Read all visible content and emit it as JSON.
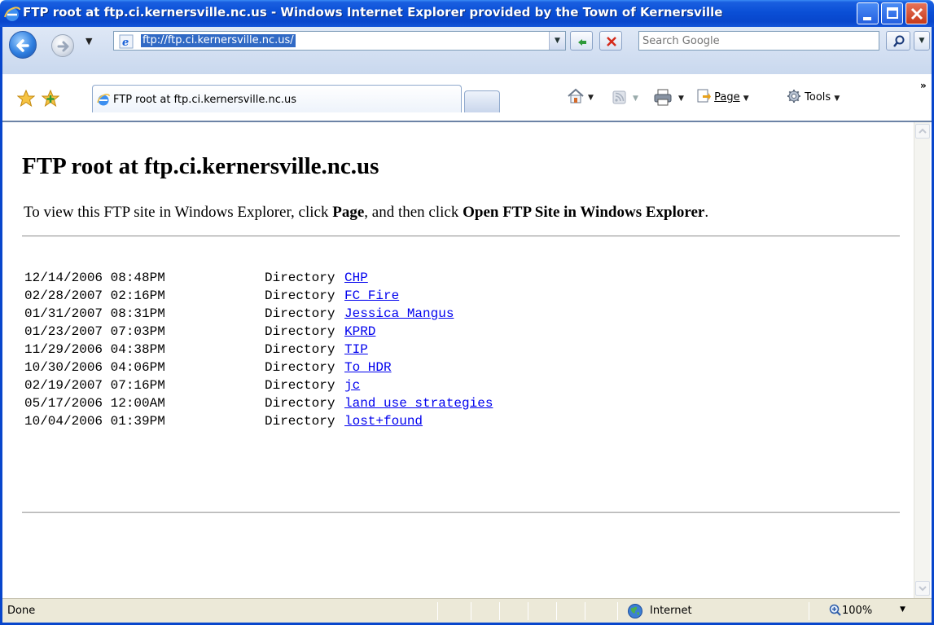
{
  "window": {
    "title": "FTP root at ftp.ci.kernersville.nc.us - Windows Internet Explorer provided by the Town of Kernersville",
    "icons": [
      "ie-logo-icon",
      "minimize-icon",
      "maximize-icon",
      "close-icon"
    ]
  },
  "nav": {
    "address_url": "ftp://ftp.ci.kernersville.nc.us/",
    "search_placeholder": "Search Google"
  },
  "tabs": {
    "active_label": "FTP root at ftp.ci.kernersville.nc.us"
  },
  "command_bar": {
    "page_label": "Page",
    "tools_label": "Tools",
    "more": "»"
  },
  "page": {
    "heading": "FTP root at ftp.ci.kernersville.nc.us",
    "intro_prefix": "To view this FTP site in Windows Explorer, click ",
    "intro_page": "Page",
    "intro_middle": ", and then click ",
    "intro_open": "Open FTP Site in Windows Explorer",
    "intro_suffix": ".",
    "entries": [
      {
        "date": "12/14/2006 08:48PM",
        "kind": "Directory",
        "name": "CHP"
      },
      {
        "date": "02/28/2007 02:16PM",
        "kind": "Directory",
        "name": "FC_Fire"
      },
      {
        "date": "01/31/2007 08:31PM",
        "kind": "Directory",
        "name": "Jessica Mangus"
      },
      {
        "date": "01/23/2007 07:03PM",
        "kind": "Directory",
        "name": "KPRD"
      },
      {
        "date": "11/29/2006 04:38PM",
        "kind": "Directory",
        "name": "TIP"
      },
      {
        "date": "10/30/2006 04:06PM",
        "kind": "Directory",
        "name": "To HDR"
      },
      {
        "date": "02/19/2007 07:16PM",
        "kind": "Directory",
        "name": "jc"
      },
      {
        "date": "05/17/2006 12:00AM",
        "kind": "Directory",
        "name": "land use strategies"
      },
      {
        "date": "10/04/2006 01:39PM",
        "kind": "Directory",
        "name": "lost+found"
      }
    ]
  },
  "status": {
    "text": "Done",
    "zone": "Internet",
    "zoom": "100%"
  },
  "colors": {
    "titlebar": "#0846cc",
    "link": "#0000ee",
    "statusbar": "#ece9d8"
  }
}
